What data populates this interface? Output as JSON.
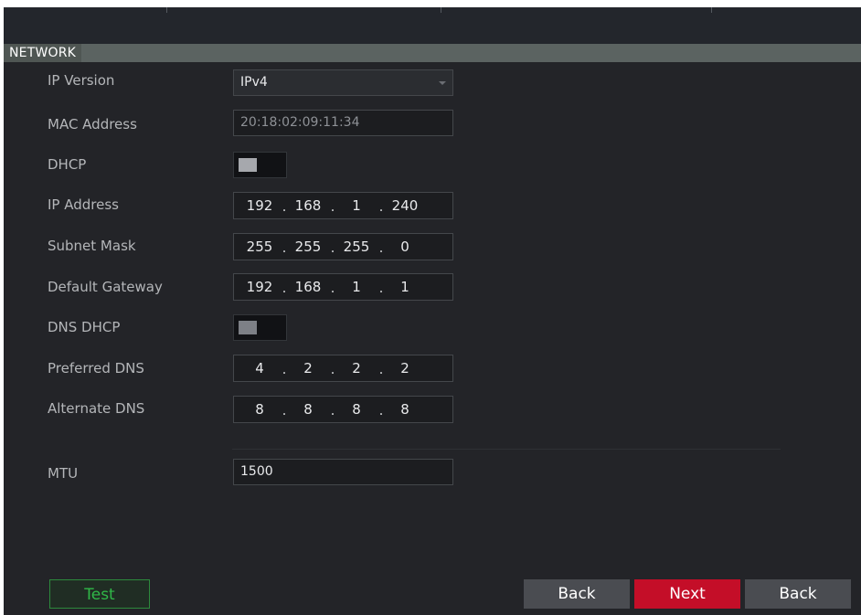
{
  "section": {
    "title": "NETWORK"
  },
  "labels": {
    "ip_version": "IP Version",
    "mac_address": "MAC Address",
    "dhcp": "DHCP",
    "ip_address": "IP Address",
    "subnet_mask": "Subnet Mask",
    "default_gateway": "Default Gateway",
    "dns_dhcp": "DNS DHCP",
    "preferred_dns": "Preferred DNS",
    "alternate_dns": "Alternate DNS",
    "mtu": "MTU"
  },
  "values": {
    "ip_version": "IPv4",
    "mac_address": "20:18:02:09:11:34",
    "dhcp_enabled": false,
    "ip_address": [
      "192",
      "168",
      "1",
      "240"
    ],
    "subnet_mask": [
      "255",
      "255",
      "255",
      "0"
    ],
    "default_gateway": [
      "192",
      "168",
      "1",
      "1"
    ],
    "dns_dhcp_enabled": false,
    "preferred_dns": [
      "4",
      "2",
      "2",
      "2"
    ],
    "alternate_dns": [
      "8",
      "8",
      "8",
      "8"
    ],
    "mtu": "1500"
  },
  "ip_separator": ".",
  "buttons": {
    "test": "Test",
    "back": "Back",
    "next": "Next",
    "back2": "Back"
  },
  "colors": {
    "accent_red": "#c40e28",
    "test_green": "#30b848",
    "panel_bg": "#232428",
    "section_bar": "#5b6361"
  }
}
